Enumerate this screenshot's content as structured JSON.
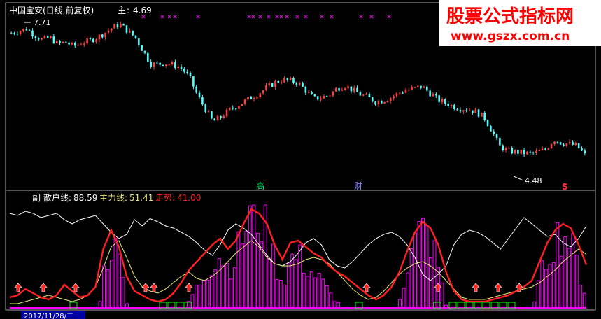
{
  "header": {
    "symbol_title": "中国宝安(日线,前复权)",
    "main_label": "主",
    "main_value": "4.69",
    "main_sep": ":"
  },
  "watermark": {
    "line1": "股票公式指标网",
    "line2": "www.gszx.com.cn"
  },
  "annotations": {
    "high_price": "7.71",
    "low_price": "4.48",
    "marker_gao": "高",
    "marker_cai": "财",
    "marker_s": "S"
  },
  "sub_panel": {
    "label": "副",
    "retail_label": "散户线",
    "retail_value": "88.59",
    "main_force_label": "主力线",
    "main_force_value": "51.41",
    "trend_label": "走势",
    "trend_value": "41.00"
  },
  "footer": {
    "date": "2017/11/28/二"
  },
  "colors": {
    "up_candle": "#ff4040",
    "down_candle": "#54fcfc",
    "cross_marker": "#ff00ff",
    "retail_line": "#ffffff",
    "main_force_line": "#e8e878",
    "trend_line": "#ff2020",
    "volume_bar": "#ff00ff",
    "green_box": "#00ff00",
    "watermark_bg": "#ffffff",
    "watermark_red": "#ff0000"
  },
  "chart_data": [
    {
      "type": "candlestick",
      "title": "中国宝安(日线,前复权)",
      "high": 7.71,
      "low": 4.48,
      "last_close": 4.69,
      "ylim": [
        4.3,
        7.9
      ],
      "close_series": [
        7.5,
        7.55,
        7.6,
        7.45,
        7.35,
        7.4,
        7.25,
        7.3,
        7.2,
        7.28,
        7.32,
        7.4,
        7.5,
        7.62,
        7.7,
        7.55,
        7.4,
        7.1,
        6.8,
        6.8,
        6.82,
        6.78,
        6.7,
        6.5,
        6.1,
        5.8,
        5.5,
        5.6,
        5.75,
        5.85,
        5.95,
        6.05,
        6.15,
        6.28,
        6.38,
        6.45,
        6.42,
        6.38,
        6.2,
        6.02,
        6.05,
        6.1,
        6.25,
        6.32,
        6.22,
        6.12,
        6.05,
        5.95,
        5.98,
        6.05,
        6.15,
        6.22,
        6.25,
        6.3,
        6.15,
        6.0,
        5.92,
        5.85,
        5.8,
        5.78,
        5.72,
        5.6,
        5.3,
        4.95,
        4.85,
        4.82,
        4.8,
        4.78,
        4.82,
        4.88,
        5.1,
        5.02,
        5.0,
        4.95,
        4.75
      ],
      "cross_markers_count": 19
    },
    {
      "type": "line",
      "title": "副",
      "ylim": [
        0,
        100
      ],
      "series": [
        {
          "name": "散户线",
          "value": 88.59,
          "values": [
            90,
            88,
            92,
            90,
            86,
            88,
            90,
            84,
            80,
            84,
            86,
            88,
            80,
            72,
            66,
            70,
            84,
            78,
            85,
            82,
            78,
            76,
            72,
            68,
            62,
            55,
            50,
            60,
            74,
            80,
            76,
            70,
            60,
            50,
            42,
            40,
            44,
            52,
            62,
            66,
            60,
            46,
            40,
            38,
            44,
            52,
            60,
            66,
            70,
            72,
            68,
            60,
            48,
            32,
            26,
            32,
            40,
            60,
            70,
            74,
            72,
            68,
            62,
            56,
            66,
            76,
            86,
            80,
            74,
            68,
            70,
            62,
            58,
            66,
            78
          ]
        },
        {
          "name": "主力线",
          "value": 51.41,
          "values": [
            4,
            4,
            6,
            8,
            10,
            12,
            10,
            8,
            6,
            8,
            12,
            20,
            38,
            58,
            64,
            48,
            30,
            20,
            16,
            14,
            18,
            24,
            30,
            34,
            28,
            26,
            30,
            36,
            44,
            52,
            58,
            64,
            58,
            48,
            42,
            40,
            40,
            42,
            46,
            48,
            46,
            42,
            34,
            26,
            18,
            12,
            8,
            10,
            16,
            24,
            32,
            38,
            42,
            44,
            40,
            34,
            26,
            18,
            10,
            8,
            8,
            8,
            10,
            12,
            14,
            16,
            18,
            20,
            24,
            30,
            36,
            44,
            50,
            56,
            51
          ]
        },
        {
          "name": "走势",
          "value": 41.0,
          "values": [
            10,
            12,
            18,
            14,
            10,
            8,
            12,
            22,
            16,
            10,
            12,
            20,
            56,
            74,
            58,
            30,
            16,
            12,
            8,
            6,
            8,
            14,
            24,
            36,
            44,
            52,
            60,
            66,
            56,
            64,
            80,
            94,
            90,
            80,
            60,
            46,
            62,
            64,
            58,
            52,
            48,
            40,
            34,
            30,
            24,
            18,
            12,
            8,
            12,
            20,
            34,
            54,
            72,
            82,
            76,
            60,
            34,
            16,
            8,
            6,
            6,
            6,
            8,
            10,
            12,
            16,
            20,
            26,
            44,
            62,
            74,
            80,
            76,
            60,
            41
          ]
        }
      ]
    }
  ]
}
